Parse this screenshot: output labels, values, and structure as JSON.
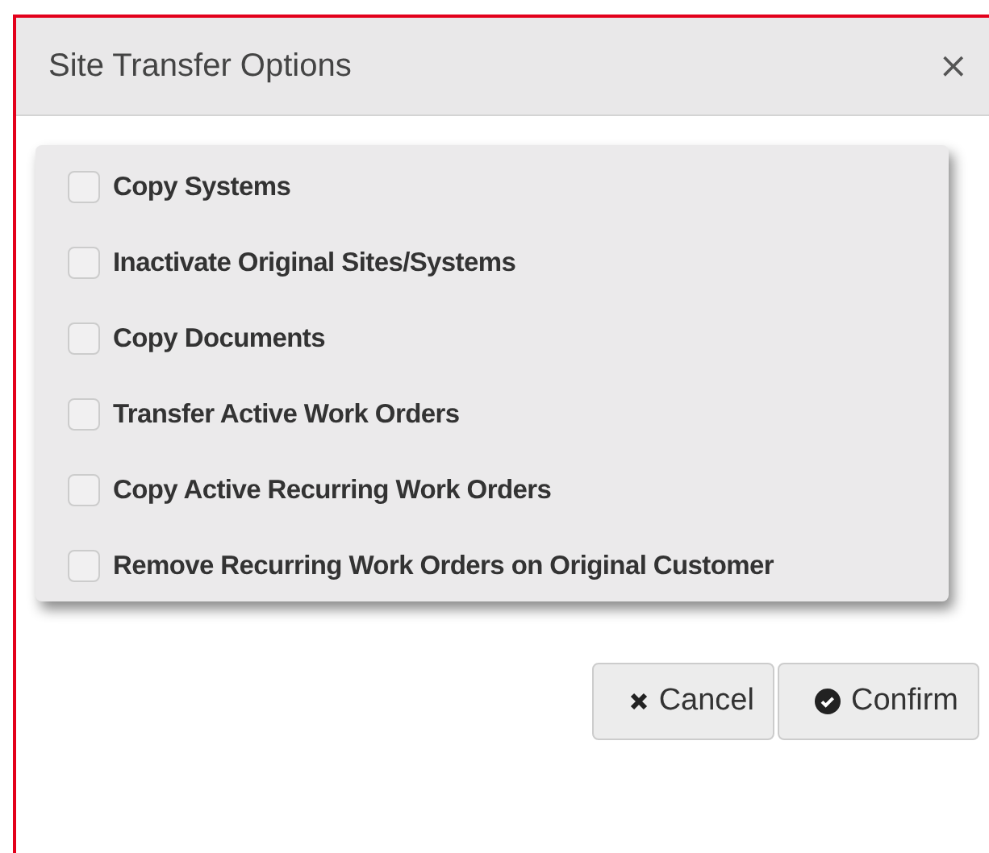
{
  "dialog": {
    "title": "Site Transfer Options",
    "close": "×"
  },
  "options": [
    {
      "label": "Copy Systems",
      "checked": false
    },
    {
      "label": "Inactivate Original Sites/Systems",
      "checked": false
    },
    {
      "label": "Copy Documents",
      "checked": false
    },
    {
      "label": "Transfer Active Work Orders",
      "checked": false
    },
    {
      "label": "Copy Active Recurring Work Orders",
      "checked": false
    },
    {
      "label": "Remove Recurring Work Orders on Original Customer",
      "checked": false
    }
  ],
  "buttons": [
    {
      "label": "Cancel",
      "kind": "cancel"
    },
    {
      "label": "Confirm",
      "kind": "confirm"
    }
  ]
}
